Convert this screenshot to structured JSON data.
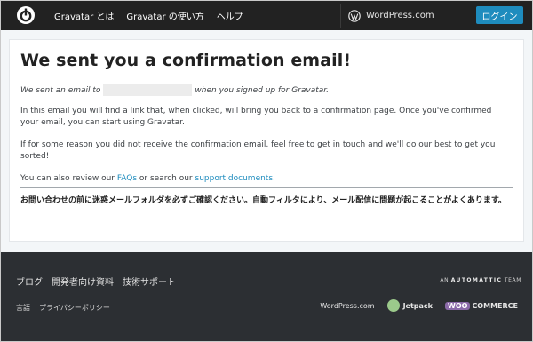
{
  "header": {
    "nav": [
      "Gravatar とは",
      "Gravatar の使い方",
      "ヘルプ"
    ],
    "wordpress_label": "WordPress.com",
    "login_label": "ログイン"
  },
  "main": {
    "title": "We sent you a confirmation email!",
    "sent_prefix": "We sent an email to",
    "sent_suffix": "when you signed up for Gravatar.",
    "para1": "In this email you will find a link that, when clicked, will bring you back to a confirmation page. Once you've confirmed your email, you can start using Gravatar.",
    "para2": "If for some reason you did not receive the confirmation email, feel free to get in touch and we'll do our best to get you sorted!",
    "review_prefix": "You can also review our",
    "faqs_link": "FAQs",
    "review_middle": "or search our",
    "support_link": "support documents",
    "review_suffix": ".",
    "jp_note": "お問い合わせの前に迷惑メールフォルダを必ずご確認ください。自動フィルタにより、メール配信に問題が起こることがよくあります。"
  },
  "footer": {
    "links": [
      "ブログ",
      "開発者向け資料",
      "技術サポート"
    ],
    "links2": [
      "言語",
      "プライバシーポリシー"
    ],
    "an": "AN",
    "automattic": "AUTOMATTIC",
    "team": "TEAM",
    "partners": {
      "wordpress": "WordPress.com",
      "jetpack": "Jetpack",
      "woo": "WOO",
      "commerce": "COMMERCE"
    }
  },
  "colors": {
    "topbar": "#222222",
    "accent": "#1e8cbe",
    "footer": "#2c2f33"
  },
  "icons": [
    "gravatar-logo-icon",
    "wordpress-icon",
    "jetpack-icon"
  ]
}
